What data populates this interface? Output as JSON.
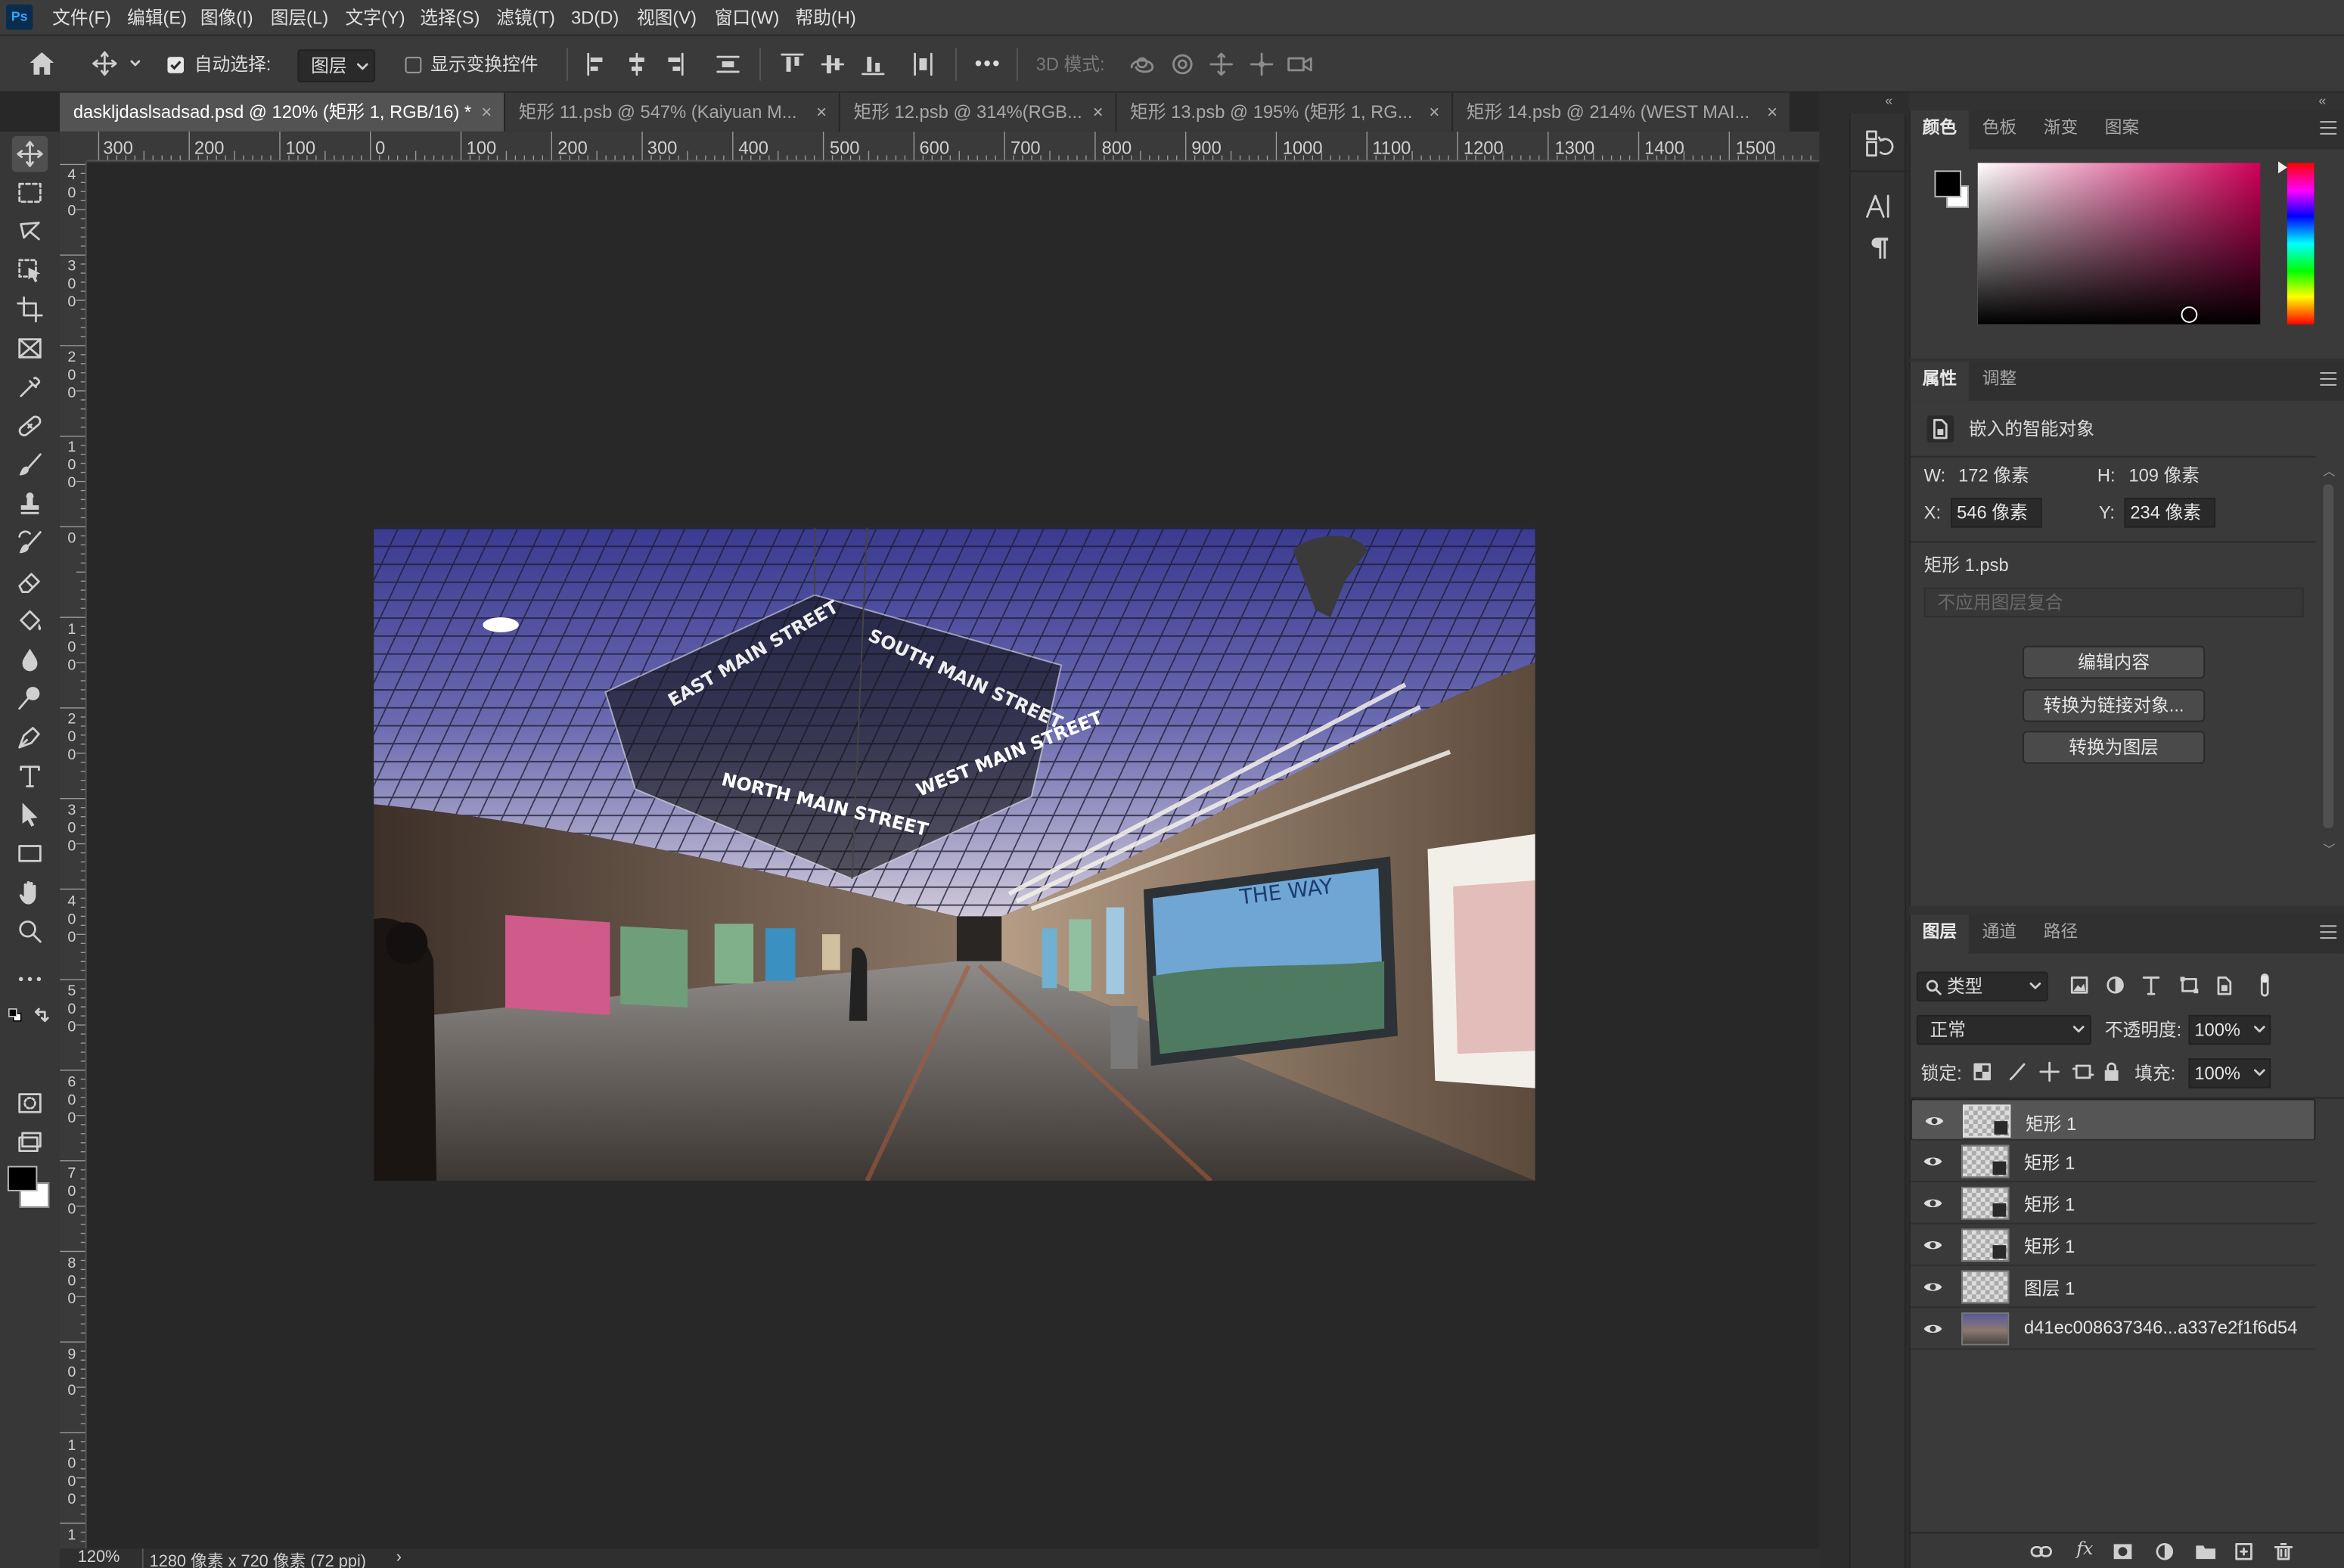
{
  "app": {
    "logo": "Ps"
  },
  "menu": [
    "文件(F)",
    "编辑(E)",
    "图像(I)",
    "图层(L)",
    "文字(Y)",
    "选择(S)",
    "滤镜(T)",
    "3D(D)",
    "视图(V)",
    "窗口(W)",
    "帮助(H)"
  ],
  "options": {
    "auto_select_label": "自动选择:",
    "auto_select_checked": true,
    "auto_select_target": "图层",
    "show_transform_label": "显示变换控件",
    "show_transform_checked": false,
    "mode_3d_label": "3D 模式:",
    "more": "•••"
  },
  "tabs": [
    {
      "label": "daskljdaslsadsad.psd @ 120% (矩形 1, RGB/16) *",
      "close": "×",
      "active": true
    },
    {
      "label": "矩形 11.psb @ 547% (Kaiyuan M...",
      "close": "×",
      "active": false
    },
    {
      "label": "矩形 12.psb @ 314%(RGB...",
      "close": "×",
      "active": false
    },
    {
      "label": "矩形 13.psb @ 195% (矩形 1, RG...",
      "close": "×",
      "active": false
    },
    {
      "label": "矩形 14.psb @ 214% (WEST MAI...",
      "close": "×",
      "active": false
    }
  ],
  "ruler": {
    "h": [
      "300",
      "200",
      "100",
      "0",
      "100",
      "200",
      "300",
      "400",
      "500",
      "600",
      "700",
      "800",
      "900",
      "1000",
      "1100",
      "1200",
      "1300",
      "1400",
      "1500"
    ],
    "v": [
      "400",
      "300",
      "200",
      "100",
      "0",
      "100",
      "200",
      "300",
      "400",
      "500",
      "600",
      "700",
      "800",
      "900",
      "1000",
      "1"
    ]
  },
  "document": {
    "scene": {
      "signs": [
        "EAST MAIN STREET",
        "SOUTH MAIN STREET",
        "NORTH MAIN STREET",
        "WEST MAIN STREET"
      ],
      "billboard": "THE WAY"
    }
  },
  "status": {
    "zoom": "120%",
    "doc_info": "1280 像素 x 720 像素 (72 ppi)",
    "arrow": "›"
  },
  "strip": {
    "collapse_left": "«",
    "collapse_right": "«",
    "expand": "»"
  },
  "color_panel": {
    "tabs": [
      "颜色",
      "色板",
      "渐变",
      "图案"
    ],
    "foreground": "#000000",
    "background": "#ffffff",
    "hue": "#d0005a"
  },
  "properties": {
    "tabs": [
      "属性",
      "调整"
    ],
    "type": "嵌入的智能对象",
    "w_label": "W:",
    "w": "172 像素",
    "h_label": "H:",
    "h": "109 像素",
    "x_label": "X:",
    "x": "546 像素",
    "y_label": "Y:",
    "y": "234 像素",
    "file": "矩形 1.psb",
    "comp": "不应用图层复合",
    "buttons": [
      "编辑内容",
      "转换为链接对象...",
      "转换为图层"
    ]
  },
  "layers": {
    "tabs": [
      "图层",
      "通道",
      "路径"
    ],
    "filter": "类型",
    "blend": "正常",
    "opacity_label": "不透明度:",
    "opacity": "100%",
    "lock_label": "锁定:",
    "fill_label": "填充:",
    "fill": "100%",
    "items": [
      {
        "name": "矩形 1",
        "kind": "smart",
        "selected": true
      },
      {
        "name": "矩形 1",
        "kind": "smart",
        "selected": false
      },
      {
        "name": "矩形 1",
        "kind": "smart",
        "selected": false
      },
      {
        "name": "矩形 1",
        "kind": "smart",
        "selected": false
      },
      {
        "name": "图层 1",
        "kind": "empty",
        "selected": false
      },
      {
        "name": "d41ec008637346...a337e2f1f6d54",
        "kind": "photo",
        "selected": false
      }
    ],
    "footer": [
      "link-icon",
      "fx-icon",
      "mask-icon",
      "adjustment-icon",
      "group-icon",
      "new-layer-icon",
      "trash-icon"
    ],
    "fx_text": "fx"
  }
}
